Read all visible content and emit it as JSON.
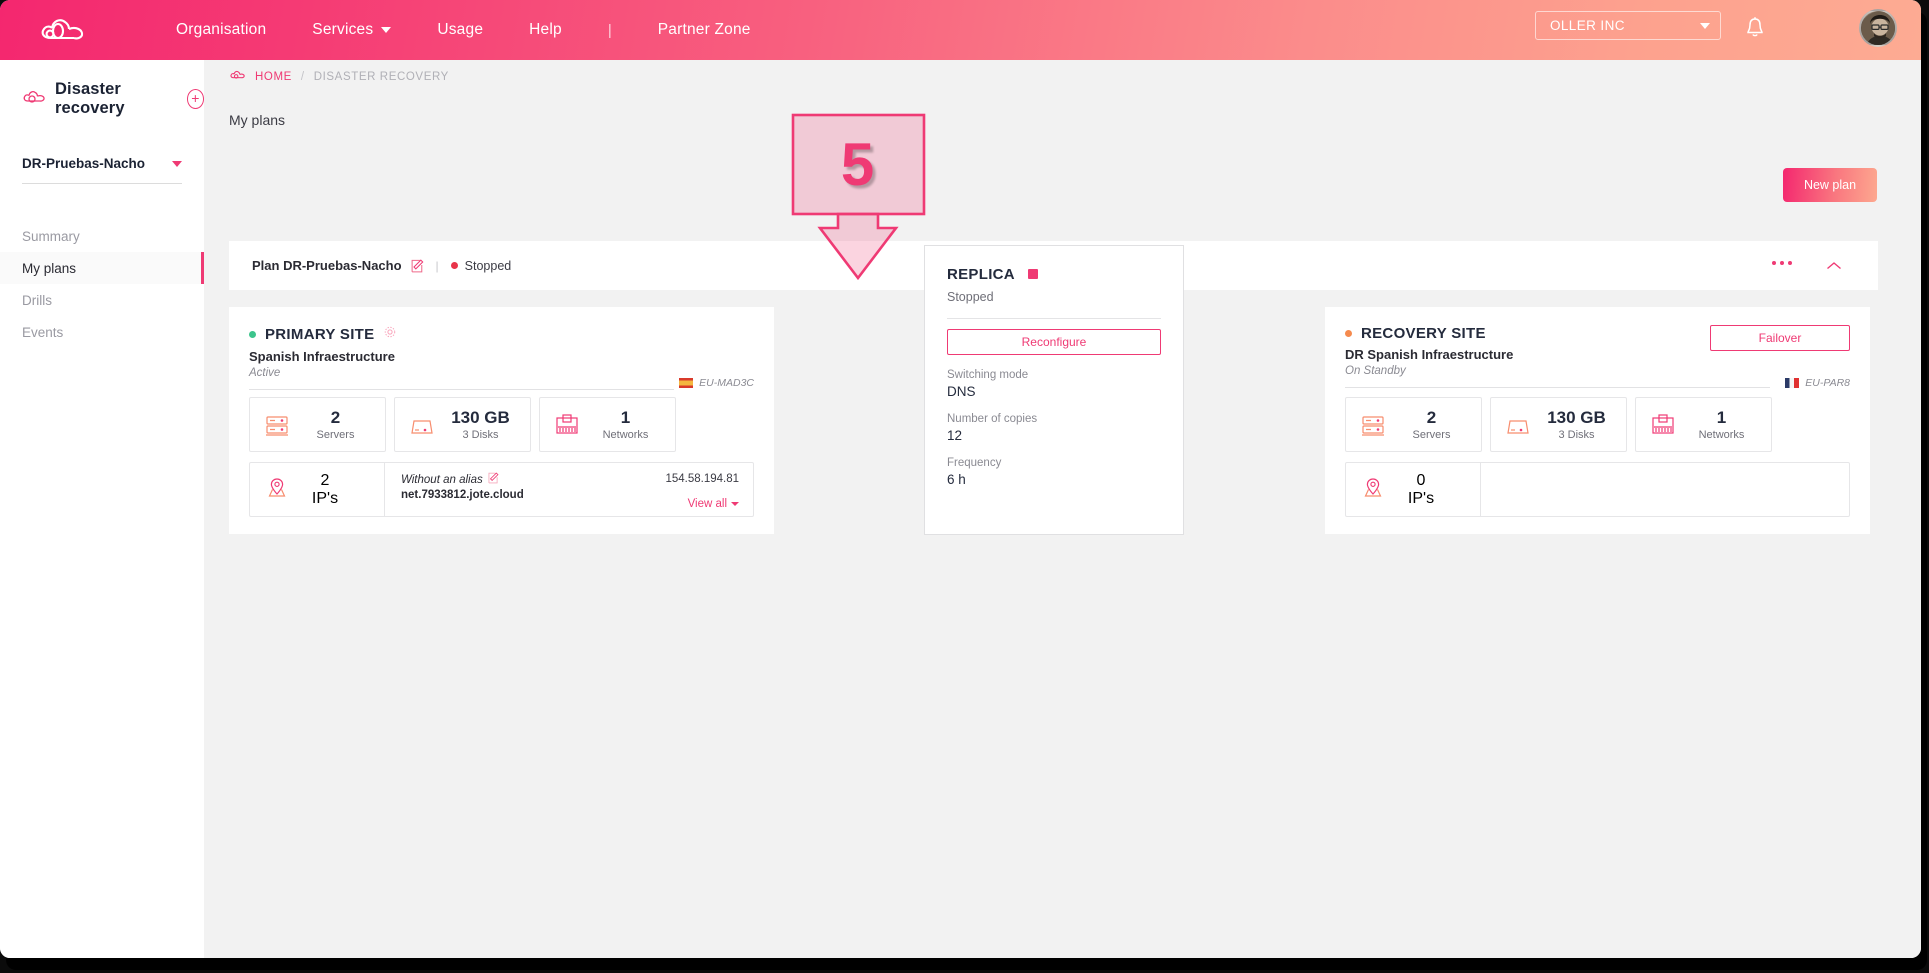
{
  "header": {
    "logo_icon": "cloud-logo-icon",
    "nav": [
      {
        "label": "Organisation",
        "has_caret": false
      },
      {
        "label": "Services",
        "has_caret": true
      },
      {
        "label": "Usage",
        "has_caret": false
      },
      {
        "label": "Help",
        "has_caret": false
      }
    ],
    "separator": "|",
    "partner_zone": "Partner Zone",
    "org_selector": {
      "value": "OLLER INC",
      "icon": "chevron-down-icon"
    },
    "bell_icon": "bell-icon",
    "avatar_icon": "user-avatar",
    "gradient_from": "#f4276f",
    "gradient_to": "#fdab93"
  },
  "sidebar": {
    "service_title": "Disaster recovery",
    "service_icon": "cloud-icon",
    "add_label": "+",
    "plan_selector": {
      "value": "DR-Pruebas-Nacho",
      "icon": "chevron-down-icon"
    },
    "items": [
      {
        "label": "Summary",
        "active": false
      },
      {
        "label": "My plans",
        "active": true
      },
      {
        "label": "Drills",
        "active": false
      },
      {
        "label": "Events",
        "active": false
      }
    ],
    "accent": "#ef3a74"
  },
  "main": {
    "breadcrumb": {
      "home_icon": "cloud-icon",
      "home": "HOME",
      "separator": "/",
      "current": "DISASTER RECOVERY"
    },
    "page_title": "My plans",
    "new_plan_label": "New plan"
  },
  "plan": {
    "title": "Plan DR-Pruebas-Nacho",
    "edit_icon": "pencil-icon",
    "separator": "|",
    "status": "Stopped",
    "status_color": "#e8344a",
    "more_icon": "more-dots-icon",
    "collapse_icon": "chevron-up-icon"
  },
  "primary_site": {
    "name": "PRIMARY SITE",
    "status_dot_color": "#3cc48c",
    "gear_icon": "gear-icon",
    "infrastructure": "Spanish Infraestructure",
    "state": "Active",
    "region": {
      "label": "EU-MAD3C",
      "flag": "es-flag-icon"
    },
    "tiles": [
      {
        "icon": "server-icon",
        "value": "2",
        "label": "Servers"
      },
      {
        "icon": "disk-icon",
        "value": "130 GB",
        "label": "3 Disks"
      },
      {
        "icon": "network-icon",
        "value": "1",
        "label": "Networks"
      }
    ],
    "ip": {
      "icon": "location-pin-icon",
      "count": "2",
      "count_label": "IP's",
      "alias": "Without an alias",
      "alias_edit_icon": "pencil-icon",
      "fqdn": "net.7933812.jote.cloud",
      "address": "154.58.194.81",
      "view_all": "View all"
    }
  },
  "replica": {
    "name": "REPLICA",
    "status_icon": "stopped-square-icon",
    "state": "Stopped",
    "reconfigure_label": "Reconfigure",
    "fields": [
      {
        "label": "Switching mode",
        "value": "DNS"
      },
      {
        "label": "Number of copies",
        "value": "12"
      },
      {
        "label": "Frequency",
        "value": "6 h"
      }
    ]
  },
  "recovery_site": {
    "name": "RECOVERY SITE",
    "status_dot_color": "#f58a4e",
    "infrastructure": "DR Spanish Infraestructure",
    "state": "On Standby",
    "action_label": "Failover",
    "region": {
      "label": "EU-PAR8",
      "flag": "fr-flag-icon"
    },
    "tiles": [
      {
        "icon": "server-icon",
        "value": "2",
        "label": "Servers"
      },
      {
        "icon": "disk-icon",
        "value": "130 GB",
        "label": "3 Disks"
      },
      {
        "icon": "network-icon",
        "value": "1",
        "label": "Networks"
      }
    ],
    "ip": {
      "icon": "location-pin-icon",
      "count": "0",
      "count_label": "IP's"
    }
  },
  "annotation": {
    "step_number": "5",
    "color": "#ef3a74",
    "points_to": "reconfigure-button"
  }
}
